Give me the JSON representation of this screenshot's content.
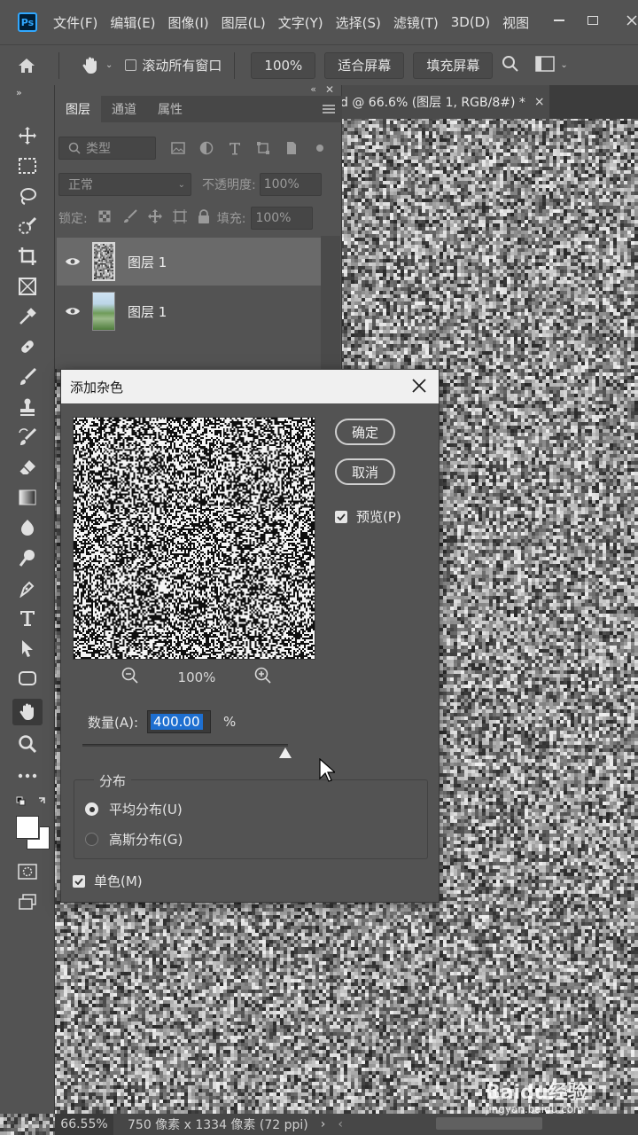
{
  "menubar": {
    "logo": "Ps",
    "items": [
      "文件(F)",
      "编辑(E)",
      "图像(I)",
      "图层(L)",
      "文字(Y)",
      "选择(S)",
      "滤镜(T)",
      "3D(D)",
      "视图"
    ]
  },
  "options": {
    "scroll_all_label": "滚动所有窗口",
    "zoom_value": "100%",
    "fit_screen": "适合屏幕",
    "fill_screen": "填充屏幕"
  },
  "document_tab": {
    "title": "d @ 66.6% (图层 1, RGB/8#) *",
    "close": "×"
  },
  "layers_panel": {
    "tabs": [
      "图层",
      "通道",
      "属性"
    ],
    "filter_placeholder": "类型",
    "blend_mode": "正常",
    "opacity_label": "不透明度:",
    "opacity_value": "100%",
    "lock_label": "锁定:",
    "fill_label": "填充:",
    "fill_value": "100%",
    "layers": [
      {
        "name": "图层 1",
        "selected": true
      },
      {
        "name": "图层 1",
        "selected": false
      }
    ]
  },
  "dialog": {
    "title": "添加杂色",
    "ok": "确定",
    "cancel": "取消",
    "preview_label": "预览(P)",
    "preview_checked": true,
    "zoom_value": "100%",
    "amount_label": "数量(A):",
    "amount_value": "400.00",
    "amount_unit": "%",
    "amount_fraction": 1.0,
    "distribution_label": "分布",
    "uniform_label": "平均分布(U)",
    "gaussian_label": "高斯分布(G)",
    "selected_distribution": "uniform",
    "mono_label": "单色(M)",
    "mono_checked": true
  },
  "statusbar": {
    "zoom": "66.55%",
    "info": "750 像素 x 1334 像素 (72 ppi)",
    "arrow": "›"
  },
  "watermark": {
    "brand": "Baidu经验",
    "url": "jingyan.baidu.com"
  },
  "colors": {
    "ui_bg": "#535353",
    "accent_selection": "#1e6fd0",
    "ps_logo": "#31a8ff"
  }
}
